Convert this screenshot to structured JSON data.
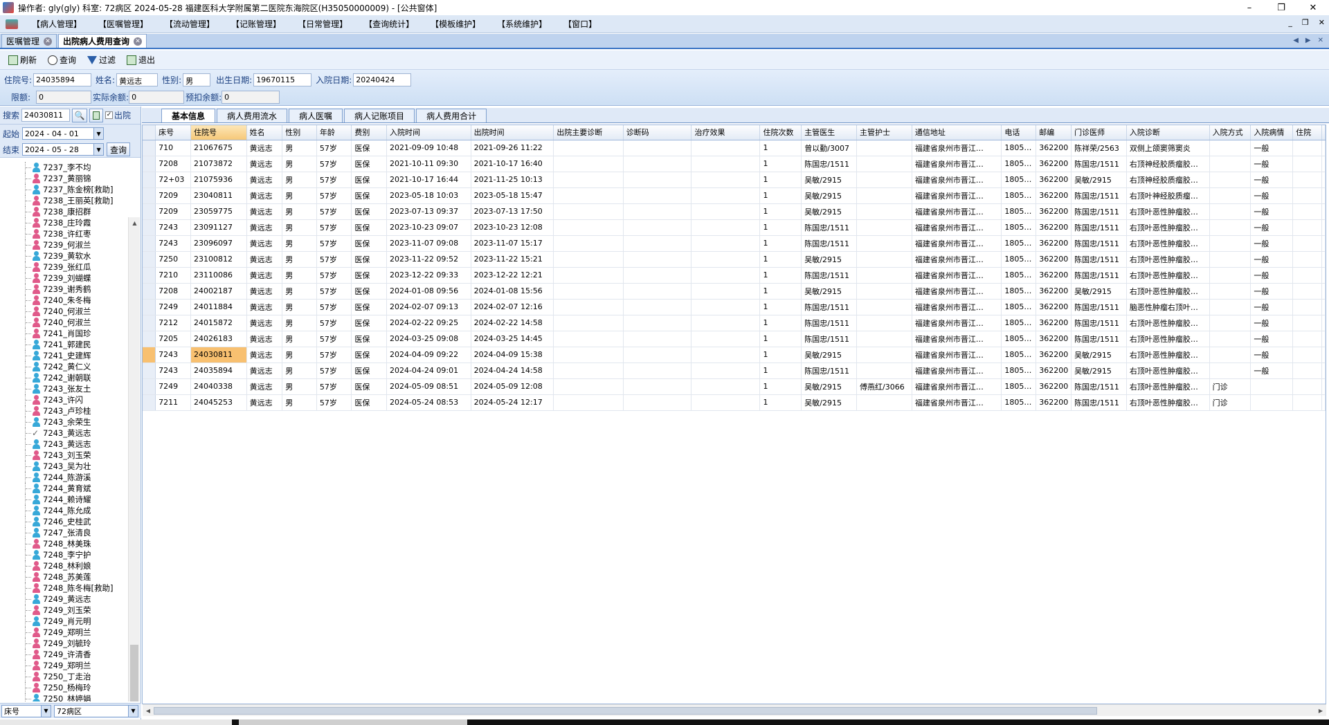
{
  "window": {
    "title": "操作者: gly(gly)  科室: 72病区  2024-05-28  福建医科大学附属第二医院东海院区(H35050000009) - [公共窗体]",
    "controls": [
      "–",
      "❐",
      "✕"
    ]
  },
  "menu": {
    "items": [
      "【病人管理】",
      "【医嘱管理】",
      "【流动管理】",
      "【记账管理】",
      "【日常管理】",
      "【查询统计】",
      "【模板维护】",
      "【系统维护】",
      "【窗口】"
    ],
    "mdi_controls": [
      "_",
      "❐",
      "✕"
    ]
  },
  "doc_tabs": [
    {
      "label": "医嘱管理",
      "active": false
    },
    {
      "label": "出院病人费用查询",
      "active": true
    }
  ],
  "toolbar": {
    "refresh": "刷新",
    "query": "查询",
    "filter": "过滤",
    "exit": "退出"
  },
  "form": {
    "admission_no_label": "住院号:",
    "admission_no": "24035894",
    "name_label": "姓名:",
    "name": "黄远志",
    "gender_label": "性别:",
    "gender": "男",
    "birth_label": "出生日期:",
    "birth": "19670115",
    "admit_date_label": "入院日期:",
    "admit_date": "20240424",
    "limit_label": "限额:",
    "limit": "0",
    "actual_balance_label": "实际余额:",
    "actual_balance": "0",
    "prededuct_label": "预扣余额:",
    "prededuct": "0"
  },
  "left": {
    "search_label": "搜索",
    "search_value": "24030811",
    "discharged_label": "出院",
    "start_label": "起始",
    "start_date": "2024 - 04 - 01",
    "end_label": "结束",
    "end_date": "2024 - 05 - 28",
    "query_button": "查询",
    "bottom_field": "床号",
    "bottom_ward": "72病区",
    "patients": [
      {
        "label": "7237_李不均",
        "g": "m"
      },
      {
        "label": "7237_黄丽锦",
        "g": "f"
      },
      {
        "label": "7237_陈金榜[救助]",
        "g": "m"
      },
      {
        "label": "7238_王丽英[救助]",
        "g": "f"
      },
      {
        "label": "7238_康招群",
        "g": "f"
      },
      {
        "label": "7238_庄玲霞",
        "g": "f"
      },
      {
        "label": "7238_许红枣",
        "g": "f"
      },
      {
        "label": "7239_何淑兰",
        "g": "f"
      },
      {
        "label": "7239_黄软水",
        "g": "m"
      },
      {
        "label": "7239_张红瓜",
        "g": "f"
      },
      {
        "label": "7239_刘蝴蝶",
        "g": "f"
      },
      {
        "label": "7239_谢秀鹤",
        "g": "f"
      },
      {
        "label": "7240_朱冬梅",
        "g": "f"
      },
      {
        "label": "7240_何淑兰",
        "g": "f"
      },
      {
        "label": "7240_何淑兰",
        "g": "f"
      },
      {
        "label": "7241_肖国珍",
        "g": "f"
      },
      {
        "label": "7241_郭建民",
        "g": "m"
      },
      {
        "label": "7241_史建辉",
        "g": "m"
      },
      {
        "label": "7242_黄仁义",
        "g": "m"
      },
      {
        "label": "7242_谢朝联",
        "g": "m"
      },
      {
        "label": "7243_张友土",
        "g": "m"
      },
      {
        "label": "7243_许闪",
        "g": "f"
      },
      {
        "label": "7243_卢珍桂",
        "g": "f"
      },
      {
        "label": "7243_余荣生",
        "g": "m"
      },
      {
        "label": "7243_黄远志",
        "g": "chk"
      },
      {
        "label": "7243_黄远志",
        "g": "m"
      },
      {
        "label": "7243_刘玉荣",
        "g": "f"
      },
      {
        "label": "7243_吴为壮",
        "g": "m"
      },
      {
        "label": "7244_陈游溪",
        "g": "m"
      },
      {
        "label": "7244_黄育斌",
        "g": "m"
      },
      {
        "label": "7244_赖诗耀",
        "g": "m"
      },
      {
        "label": "7244_陈允成",
        "g": "m"
      },
      {
        "label": "7246_史桂武",
        "g": "m"
      },
      {
        "label": "7247_张清良",
        "g": "m"
      },
      {
        "label": "7248_林美珠",
        "g": "f"
      },
      {
        "label": "7248_李宁护",
        "g": "m"
      },
      {
        "label": "7248_林利娘",
        "g": "f"
      },
      {
        "label": "7248_苏美莲",
        "g": "f"
      },
      {
        "label": "7248_陈冬梅[救助]",
        "g": "f"
      },
      {
        "label": "7249_黄远志",
        "g": "m"
      },
      {
        "label": "7249_刘玉荣",
        "g": "f"
      },
      {
        "label": "7249_肖元明",
        "g": "m"
      },
      {
        "label": "7249_郑明兰",
        "g": "f"
      },
      {
        "label": "7249_刘毓玲",
        "g": "f"
      },
      {
        "label": "7249_许清香",
        "g": "f"
      },
      {
        "label": "7249_郑明兰",
        "g": "f"
      },
      {
        "label": "7250_丁走治",
        "g": "f"
      },
      {
        "label": "7250_杨梅玲",
        "g": "f"
      },
      {
        "label": "7250_林婷娟",
        "g": "m"
      }
    ]
  },
  "sub_tabs": [
    {
      "label": "基本信息",
      "active": true
    },
    {
      "label": "病人费用流水",
      "active": false
    },
    {
      "label": "病人医嘱",
      "active": false
    },
    {
      "label": "病人记账项目",
      "active": false
    },
    {
      "label": "病人费用合计",
      "active": false
    }
  ],
  "table": {
    "columns": [
      "床号",
      "住院号",
      "姓名",
      "性别",
      "年龄",
      "费别",
      "入院时间",
      "出院时间",
      "出院主要诊断",
      "诊断码",
      "治疗效果",
      "住院次数",
      "主管医生",
      "主管护士",
      "通信地址",
      "电话",
      "邮编",
      "门诊医师",
      "入院诊断",
      "入院方式",
      "入院病情",
      "住院"
    ],
    "selected_row": 13,
    "rows": [
      [
        "710",
        "21067675",
        "黄远志",
        "男",
        "57岁",
        "医保",
        "2021-09-09 10:48",
        "2021-09-26 11:22",
        "",
        "",
        "",
        "1",
        "曾以勤/3007",
        "",
        "福建省泉州市晋江…",
        "1805…",
        "362200",
        "陈祥荣/2563",
        "双侧上颌窦筛窦炎",
        "",
        "一般",
        ""
      ],
      [
        "7208",
        "21073872",
        "黄远志",
        "男",
        "57岁",
        "医保",
        "2021-10-11 09:30",
        "2021-10-17 16:40",
        "",
        "",
        "",
        "1",
        "陈国忠/1511",
        "",
        "福建省泉州市晋江…",
        "1805…",
        "362200",
        "陈国忠/1511",
        "右顶神经胶质瘤胶…",
        "",
        "一般",
        ""
      ],
      [
        "72+03",
        "21075936",
        "黄远志",
        "男",
        "57岁",
        "医保",
        "2021-10-17 16:44",
        "2021-11-25 10:13",
        "",
        "",
        "",
        "1",
        "吴敏/2915",
        "",
        "福建省泉州市晋江…",
        "1805…",
        "362200",
        "吴敏/2915",
        "右顶神经胶质瘤胶…",
        "",
        "一般",
        ""
      ],
      [
        "7209",
        "23040811",
        "黄远志",
        "男",
        "57岁",
        "医保",
        "2023-05-18 10:03",
        "2023-05-18 15:47",
        "",
        "",
        "",
        "1",
        "吴敏/2915",
        "",
        "福建省泉州市晋江…",
        "1805…",
        "362200",
        "陈国忠/1511",
        "右顶叶神经胶质瘤…",
        "",
        "一般",
        ""
      ],
      [
        "7209",
        "23059775",
        "黄远志",
        "男",
        "57岁",
        "医保",
        "2023-07-13 09:37",
        "2023-07-13 17:50",
        "",
        "",
        "",
        "1",
        "吴敏/2915",
        "",
        "福建省泉州市晋江…",
        "1805…",
        "362200",
        "陈国忠/1511",
        "右顶叶恶性肿瘤胶…",
        "",
        "一般",
        ""
      ],
      [
        "7243",
        "23091127",
        "黄远志",
        "男",
        "57岁",
        "医保",
        "2023-10-23 09:07",
        "2023-10-23 12:08",
        "",
        "",
        "",
        "1",
        "陈国忠/1511",
        "",
        "福建省泉州市晋江…",
        "1805…",
        "362200",
        "陈国忠/1511",
        "右顶叶恶性肿瘤胶…",
        "",
        "一般",
        ""
      ],
      [
        "7243",
        "23096097",
        "黄远志",
        "男",
        "57岁",
        "医保",
        "2023-11-07 09:08",
        "2023-11-07 15:17",
        "",
        "",
        "",
        "1",
        "陈国忠/1511",
        "",
        "福建省泉州市晋江…",
        "1805…",
        "362200",
        "陈国忠/1511",
        "右顶叶恶性肿瘤胶…",
        "",
        "一般",
        ""
      ],
      [
        "7250",
        "23100812",
        "黄远志",
        "男",
        "57岁",
        "医保",
        "2023-11-22 09:52",
        "2023-11-22 15:21",
        "",
        "",
        "",
        "1",
        "吴敏/2915",
        "",
        "福建省泉州市晋江…",
        "1805…",
        "362200",
        "陈国忠/1511",
        "右顶叶恶性肿瘤胶…",
        "",
        "一般",
        ""
      ],
      [
        "7210",
        "23110086",
        "黄远志",
        "男",
        "57岁",
        "医保",
        "2023-12-22 09:33",
        "2023-12-22 12:21",
        "",
        "",
        "",
        "1",
        "陈国忠/1511",
        "",
        "福建省泉州市晋江…",
        "1805…",
        "362200",
        "陈国忠/1511",
        "右顶叶恶性肿瘤胶…",
        "",
        "一般",
        ""
      ],
      [
        "7208",
        "24002187",
        "黄远志",
        "男",
        "57岁",
        "医保",
        "2024-01-08 09:56",
        "2024-01-08 15:56",
        "",
        "",
        "",
        "1",
        "吴敏/2915",
        "",
        "福建省泉州市晋江…",
        "1805…",
        "362200",
        "吴敏/2915",
        "右顶叶恶性肿瘤胶…",
        "",
        "一般",
        ""
      ],
      [
        "7249",
        "24011884",
        "黄远志",
        "男",
        "57岁",
        "医保",
        "2024-02-07 09:13",
        "2024-02-07 12:16",
        "",
        "",
        "",
        "1",
        "陈国忠/1511",
        "",
        "福建省泉州市晋江…",
        "1805…",
        "362200",
        "陈国忠/1511",
        "脑恶性肿瘤右顶叶…",
        "",
        "一般",
        ""
      ],
      [
        "7212",
        "24015872",
        "黄远志",
        "男",
        "57岁",
        "医保",
        "2024-02-22 09:25",
        "2024-02-22 14:58",
        "",
        "",
        "",
        "1",
        "陈国忠/1511",
        "",
        "福建省泉州市晋江…",
        "1805…",
        "362200",
        "陈国忠/1511",
        "右顶叶恶性肿瘤胶…",
        "",
        "一般",
        ""
      ],
      [
        "7205",
        "24026183",
        "黄远志",
        "男",
        "57岁",
        "医保",
        "2024-03-25 09:08",
        "2024-03-25 14:45",
        "",
        "",
        "",
        "1",
        "陈国忠/1511",
        "",
        "福建省泉州市晋江…",
        "1805…",
        "362200",
        "陈国忠/1511",
        "右顶叶恶性肿瘤胶…",
        "",
        "一般",
        ""
      ],
      [
        "7243",
        "24030811",
        "黄远志",
        "男",
        "57岁",
        "医保",
        "2024-04-09 09:22",
        "2024-04-09 15:38",
        "",
        "",
        "",
        "1",
        "吴敏/2915",
        "",
        "福建省泉州市晋江…",
        "1805…",
        "362200",
        "吴敏/2915",
        "右顶叶恶性肿瘤胶…",
        "",
        "一般",
        ""
      ],
      [
        "7243",
        "24035894",
        "黄远志",
        "男",
        "57岁",
        "医保",
        "2024-04-24 09:01",
        "2024-04-24 14:58",
        "",
        "",
        "",
        "1",
        "陈国忠/1511",
        "",
        "福建省泉州市晋江…",
        "1805…",
        "362200",
        "吴敏/2915",
        "右顶叶恶性肿瘤胶…",
        "",
        "一般",
        ""
      ],
      [
        "7249",
        "24040338",
        "黄远志",
        "男",
        "57岁",
        "医保",
        "2024-05-09 08:51",
        "2024-05-09 12:08",
        "",
        "",
        "",
        "1",
        "吴敏/2915",
        "傅燕红/3066",
        "福建省泉州市晋江…",
        "1805…",
        "362200",
        "陈国忠/1511",
        "右顶叶恶性肿瘤胶…",
        "门诊",
        "",
        ""
      ],
      [
        "7211",
        "24045253",
        "黄远志",
        "男",
        "57岁",
        "医保",
        "2024-05-24 08:53",
        "2024-05-24 12:17",
        "",
        "",
        "",
        "1",
        "吴敏/2915",
        "",
        "福建省泉州市晋江…",
        "1805…",
        "362200",
        "陈国忠/1511",
        "右顶叶恶性肿瘤胶…",
        "门诊",
        "",
        ""
      ]
    ]
  }
}
